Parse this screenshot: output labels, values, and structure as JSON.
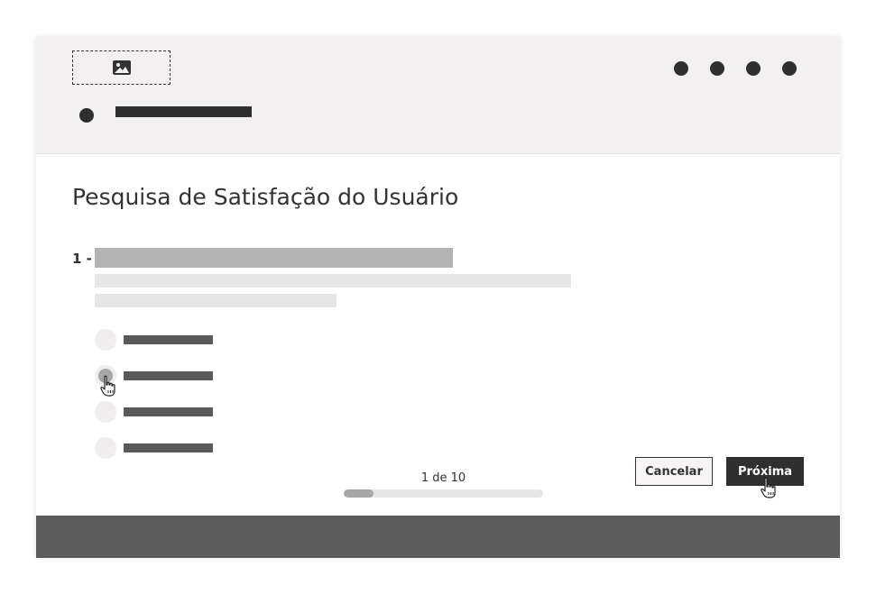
{
  "survey": {
    "title": "Pesquisa de Satisfação do Usuário",
    "question_number": "1 -",
    "options_count_visible": 4
  },
  "header": {
    "logo_icon": "image-icon",
    "menu_icons": [
      "dot-icon",
      "dot-icon",
      "dot-icon",
      "dot-icon"
    ]
  },
  "actions": {
    "cancel_label": "Cancelar",
    "next_label": "Próxima"
  },
  "progress": {
    "text": "1 de 10",
    "current": 1,
    "total": 10,
    "fraction": 0.15
  },
  "colors": {
    "header_bg": "#f2f0f1",
    "dark": "#2f2f2f",
    "footer_bg": "#5c5c5c",
    "placeholder_dark": "#b3b3b3",
    "placeholder_light": "#e6e6e6"
  },
  "cursor_icon": "hand-pointer-icon"
}
